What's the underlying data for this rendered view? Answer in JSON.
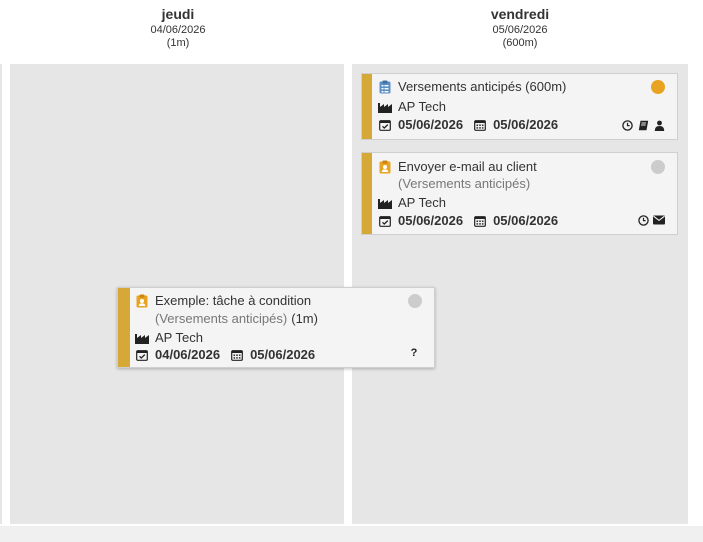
{
  "columns": [
    {
      "day": "jeudi",
      "date": "04/06/2026",
      "duration": "(1m)"
    },
    {
      "day": "vendredi",
      "date": "05/06/2026",
      "duration": "(600m)"
    }
  ],
  "cards": {
    "versements": {
      "title": "Versements anticipés (600m)",
      "company": "AP Tech",
      "start_date": "05/06/2026",
      "end_date": "05/06/2026",
      "status_color": "#e9a322"
    },
    "email": {
      "title": "Envoyer e-mail au client",
      "subtitle": "(Versements anticipés)",
      "company": "AP Tech",
      "start_date": "05/06/2026",
      "end_date": "05/06/2026",
      "status_color": "#cccccc"
    },
    "exemple": {
      "title": "Exemple: tâche à condition",
      "subtitle": "(Versements anticipés)",
      "duration": "(1m)",
      "company": "AP Tech",
      "start_date": "04/06/2026",
      "end_date": "05/06/2026",
      "unknown_label": "?",
      "status_color": "#cccccc"
    }
  },
  "colors": {
    "accent_bar": "#d6a838",
    "column_bg": "#e6e6e6",
    "card_bg": "#f4f4f4",
    "clipboard_icon": "#5b8fc7",
    "person_badge_icon": "#e9a322"
  }
}
